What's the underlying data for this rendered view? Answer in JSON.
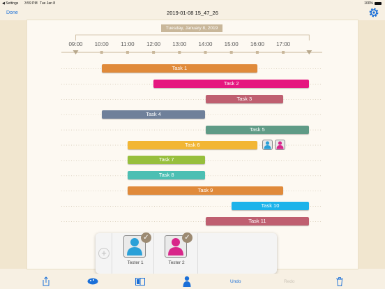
{
  "status_bar": {
    "back": "◀ Settings",
    "time": "3:59 PM",
    "date": "Tue Jan 8",
    "battery": "100%"
  },
  "nav": {
    "done": "Done",
    "title": "2019-01-08 15_47_26",
    "settings_icon": "gear-icon"
  },
  "timeline": {
    "date": "Tuesday, January 8, 2019",
    "hours": [
      "09:00",
      "10:00",
      "11:00",
      "12:00",
      "13:00",
      "14:00",
      "15:00",
      "16:00",
      "17:00"
    ]
  },
  "tasks": [
    {
      "name": "Task 1",
      "start": 10,
      "end": 16,
      "color": "#e08a3a"
    },
    {
      "name": "Task 2",
      "start": 12,
      "end": 18,
      "color": "#e5177f"
    },
    {
      "name": "Task 3",
      "start": 14,
      "end": 17,
      "color": "#bf5f70"
    },
    {
      "name": "Task 4",
      "start": 10,
      "end": 14,
      "color": "#6f809a"
    },
    {
      "name": "Task 5",
      "start": 14,
      "end": 18,
      "color": "#5f9b86"
    },
    {
      "name": "Task 6",
      "start": 11,
      "end": 16,
      "color": "#f2b634",
      "assignees": [
        "tester-1",
        "tester-2"
      ]
    },
    {
      "name": "Task 7",
      "start": 11,
      "end": 14,
      "color": "#97bf3c"
    },
    {
      "name": "Task 8",
      "start": 11,
      "end": 14,
      "color": "#4cbfb3"
    },
    {
      "name": "Task 9",
      "start": 11,
      "end": 17,
      "color": "#e08a3a"
    },
    {
      "name": "Task 10",
      "start": 15,
      "end": 18,
      "color": "#1db3ea"
    },
    {
      "name": "Task 11",
      "start": 14,
      "end": 18,
      "color": "#bf5f70"
    }
  ],
  "testers": [
    {
      "name": "Tester 1",
      "color": "#2aa0d8",
      "checked": true
    },
    {
      "name": "Tester 2",
      "color": "#d8268a",
      "checked": true
    }
  ],
  "toolbar": {
    "undo": "Undo",
    "redo": "Redo",
    "icons": [
      "share-icon",
      "palette-icon",
      "panel-icon",
      "person-icon",
      "trash-icon"
    ]
  }
}
